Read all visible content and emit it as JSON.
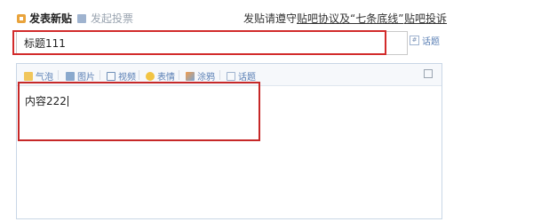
{
  "header": {
    "post_tab": "发表新贴",
    "vote_tab": "发起投票",
    "rules_prefix": "发贴请遵守",
    "rules_link": "贴吧协议及“七条底线”",
    "report_link": "贴吧投诉"
  },
  "title": {
    "value": "标题111",
    "topic_label": "话题"
  },
  "toolbar": {
    "items": [
      {
        "label": "气泡",
        "icon": "bubble-icon"
      },
      {
        "label": "图片",
        "icon": "image-icon"
      },
      {
        "label": "视频",
        "icon": "video-icon"
      },
      {
        "label": "表情",
        "icon": "emoji-icon"
      },
      {
        "label": "涂鸦",
        "icon": "graffiti-icon"
      },
      {
        "label": "话题",
        "icon": "topic-icon"
      }
    ]
  },
  "editor": {
    "content": "内容222"
  },
  "colors": {
    "highlight": "#d22b2b",
    "link": "#5a7fb5",
    "toolbar_bg": "#f6f8fb"
  }
}
